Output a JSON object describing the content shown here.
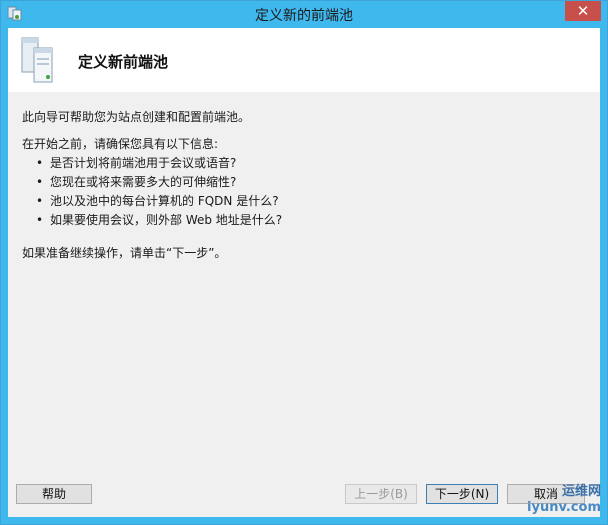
{
  "window": {
    "title": "定义新的前端池",
    "close_glyph": "✕"
  },
  "header": {
    "title": "定义新前端池"
  },
  "content": {
    "intro": "此向导可帮助您为站点创建和配置前端池。",
    "checklist_heading": "在开始之前，请确保您具有以下信息:",
    "bullets": [
      "是否计划将前端池用于会议或语音?",
      "您现在或将来需要多大的可伸缩性?",
      "池以及池中的每台计算机的 FQDN 是什么?",
      "如果要使用会议，则外部 Web 地址是什么?"
    ],
    "ready_text": "如果准备继续操作，请单击“下一步”。"
  },
  "buttons": {
    "help": "帮助",
    "back": "上一步(B)",
    "next": "下一步(N)",
    "cancel": "取消"
  },
  "watermark": {
    "line1": "运维网",
    "line2": "iyunv.com"
  },
  "icons": {
    "app": "wizard-app-icon",
    "header": "server-stack-icon"
  },
  "colors": {
    "titlebar": "#3fb8ee",
    "close": "#c7504a",
    "client": "#f0f0f0"
  }
}
